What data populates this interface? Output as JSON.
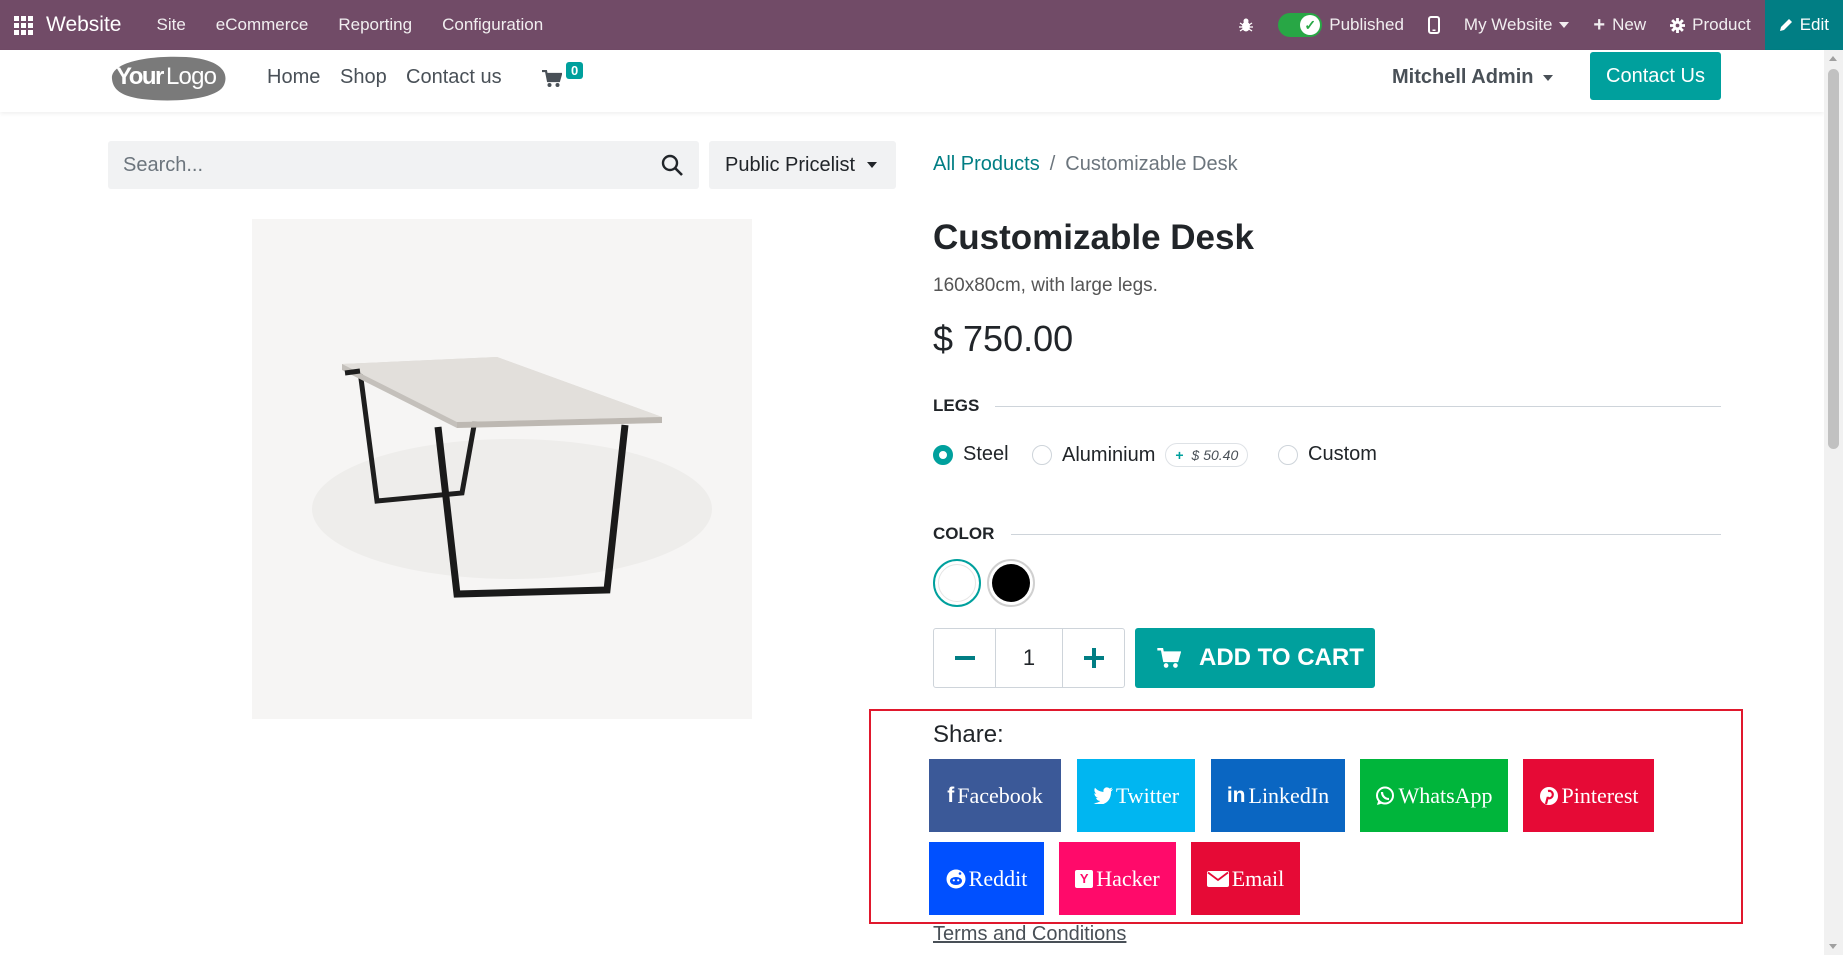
{
  "adminbar": {
    "brand": "Website",
    "menu": [
      "Site",
      "eCommerce",
      "Reporting",
      "Configuration"
    ],
    "published_label": "Published",
    "website_selector": "My Website",
    "new_label": "New",
    "product_label": "Product",
    "edit_label": "Edit"
  },
  "header": {
    "logo_text_bold": "Your",
    "logo_text_light": "Logo",
    "nav": [
      "Home",
      "Shop",
      "Contact us"
    ],
    "cart_count": "0",
    "user": "Mitchell Admin",
    "contact_button": "Contact Us"
  },
  "search": {
    "placeholder": "Search...",
    "pricelist": "Public Pricelist"
  },
  "breadcrumb": {
    "root": "All Products",
    "separator": "/",
    "current": "Customizable Desk"
  },
  "product": {
    "name": "Customizable Desk",
    "description": "160x80cm, with large legs.",
    "price": "$ 750.00",
    "legs": {
      "label": "LEGS",
      "options": [
        "Steel",
        "Aluminium",
        "Custom"
      ],
      "selected": "Steel",
      "aluminium_extra_sign": "+",
      "aluminium_extra": "$ 50.40"
    },
    "color": {
      "label": "COLOR",
      "options": [
        {
          "name": "white",
          "hex": "#ffffff",
          "selected": true
        },
        {
          "name": "black",
          "hex": "#000000",
          "selected": false
        }
      ]
    },
    "quantity": "1",
    "add_to_cart": "ADD TO CART"
  },
  "share": {
    "label": "Share:",
    "buttons": [
      {
        "label": "Facebook",
        "icon": "f",
        "color": "#3b5998"
      },
      {
        "label": "Twitter",
        "icon": "twitter-bird",
        "color": "#00b6f1"
      },
      {
        "label": "LinkedIn",
        "icon": "in",
        "color": "#0a66c2"
      },
      {
        "label": "WhatsApp",
        "icon": "whatsapp",
        "color": "#00b53b"
      },
      {
        "label": "Pinterest",
        "icon": "pinterest",
        "color": "#e60a36"
      },
      {
        "label": "Reddit",
        "icon": "reddit",
        "color": "#0050ff"
      },
      {
        "label": "Hacker",
        "icon": "Y",
        "color": "#ff0a6a"
      },
      {
        "label": "Email",
        "icon": "envelope",
        "color": "#e60a36"
      }
    ],
    "terms": "Terms and Conditions"
  },
  "colors": {
    "admin_bar": "#714b67",
    "accent": "#00a09d",
    "edit_button": "#017e84",
    "highlight_border": "#e0182d"
  }
}
